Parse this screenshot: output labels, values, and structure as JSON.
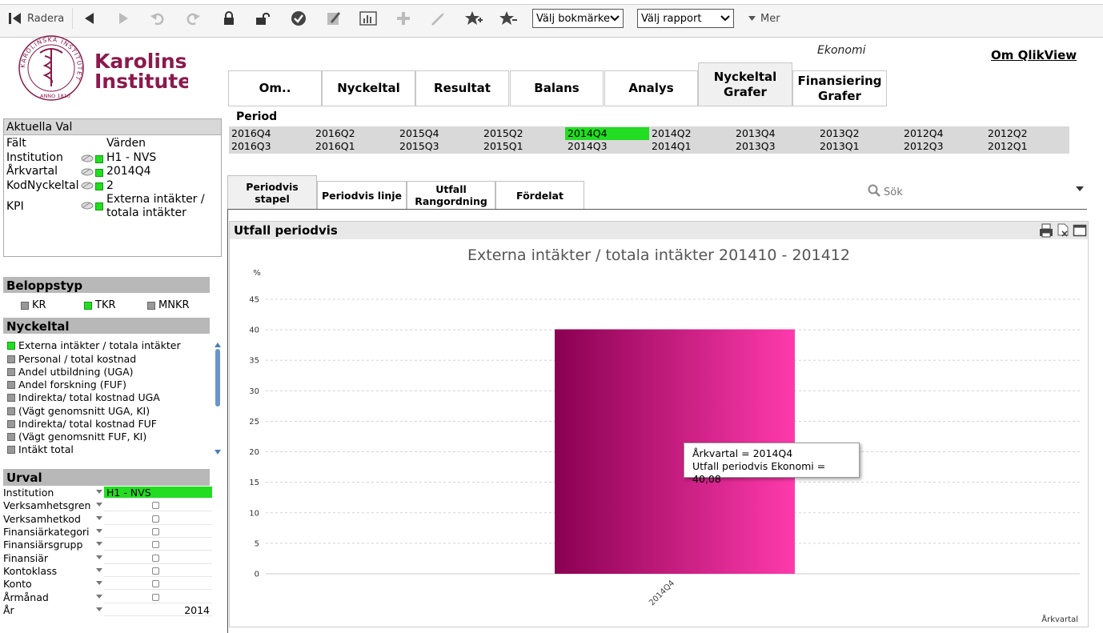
{
  "toolbar": {
    "clear_label": "Radera",
    "bookmark_select": "Välj bokmärke",
    "report_select": "Välj rapport",
    "more_label": "Mer"
  },
  "header": {
    "logo_line1": "Karolinska",
    "logo_line2": "Institutet",
    "seal_text": "KAROLINSKA INSTITUTET · ANNO 1810",
    "section_label": "Ekonomi",
    "about_link": "Om QlikView"
  },
  "main_tabs": [
    {
      "label": "Om..",
      "active": false
    },
    {
      "label": "Nyckeltal",
      "active": false
    },
    {
      "label": "Resultat",
      "active": false
    },
    {
      "label": "Balans",
      "active": false
    },
    {
      "label": "Analys",
      "active": false
    },
    {
      "label": "Nyckeltal Grafer",
      "active": true
    },
    {
      "label": "Finansiering Grafer",
      "active": false
    }
  ],
  "current_selections": {
    "title": "Aktuella Val",
    "col_field": "Fält",
    "col_values": "Värden",
    "rows": [
      {
        "field": "Institution",
        "value": "H1 - NVS"
      },
      {
        "field": "Årkvartal",
        "value": "2014Q4"
      },
      {
        "field": "KodNyckeltal",
        "value": "2"
      },
      {
        "field": "KPI",
        "value": "Externa intäkter / totala intäkter"
      }
    ]
  },
  "beloppstyp": {
    "title": "Beloppstyp",
    "options": [
      {
        "label": "KR",
        "selected": false
      },
      {
        "label": "TKR",
        "selected": true
      },
      {
        "label": "MNKR",
        "selected": false
      }
    ]
  },
  "nyckeltal": {
    "title": "Nyckeltal",
    "items": [
      {
        "label": "Externa intäkter / totala intäkter",
        "selected": true
      },
      {
        "label": "Personal / total kostnad",
        "selected": false
      },
      {
        "label": "Andel utbildning (UGA)",
        "selected": false
      },
      {
        "label": "Andel forskning (FUF)",
        "selected": false
      },
      {
        "label": "Indirekta/ total kostnad UGA",
        "selected": false
      },
      {
        "label": "(Vägt genomsnitt UGA, KI)",
        "selected": false
      },
      {
        "label": "Indirekta/ total kostnad FUF",
        "selected": false
      },
      {
        "label": "(Vägt genomsnitt FUF, KI)",
        "selected": false
      },
      {
        "label": "Intäkt total",
        "selected": false
      }
    ]
  },
  "urval": {
    "title": "Urval",
    "rows": [
      {
        "label": "Institution",
        "value": "H1 - NVS",
        "selected": true
      },
      {
        "label": "Verksamhetsgren",
        "value": "",
        "selected": false
      },
      {
        "label": "Verksamhetkod",
        "value": "",
        "selected": false
      },
      {
        "label": "Finansiärkategori",
        "value": "",
        "selected": false
      },
      {
        "label": "Finansiärsgrupp",
        "value": "",
        "selected": false
      },
      {
        "label": "Finansiär",
        "value": "",
        "selected": false
      },
      {
        "label": "Kontoklass",
        "value": "",
        "selected": false
      },
      {
        "label": "Konto",
        "value": "",
        "selected": false
      },
      {
        "label": "Årmånad",
        "value": "",
        "selected": false
      },
      {
        "label": "År",
        "value": "2014",
        "selected": false
      }
    ]
  },
  "period": {
    "label": "Period",
    "cells": [
      [
        "2016Q4",
        "2016Q3"
      ],
      [
        "2016Q2",
        "2016Q1"
      ],
      [
        "2015Q4",
        "2015Q3"
      ],
      [
        "2015Q2",
        "2015Q1"
      ],
      [
        "2014Q4",
        "2014Q3"
      ],
      [
        "2014Q2",
        "2014Q1"
      ],
      [
        "2013Q4",
        "2013Q3"
      ],
      [
        "2013Q2",
        "2013Q1"
      ],
      [
        "2012Q4",
        "2012Q3"
      ],
      [
        "2012Q2",
        "2012Q1"
      ]
    ],
    "selected": "2014Q4"
  },
  "sub_tabs": [
    {
      "label": "Periodvis stapel",
      "active": true
    },
    {
      "label": "Periodvis linje",
      "active": false
    },
    {
      "label": "Utfall Rangordning",
      "active": false
    },
    {
      "label": "Fördelat",
      "active": false
    }
  ],
  "search": {
    "placeholder": "Sök"
  },
  "chart_object": {
    "caption": "Utfall periodvis"
  },
  "chart_data": {
    "type": "bar",
    "title": "Externa intäkter / totala intäkter 201410 - 201412",
    "ylabel": "%",
    "xlabel": "Årkvartal",
    "categories": [
      "2014Q4"
    ],
    "values": [
      40.08
    ],
    "ylim": [
      0,
      45
    ],
    "yticks": [
      0,
      5,
      10,
      15,
      20,
      25,
      30,
      35,
      40,
      45
    ],
    "grid": true,
    "bar_gradient": [
      "#8a0052",
      "#ff3aac"
    ]
  },
  "tooltip": {
    "line1": "Årkvartal = 2014Q4",
    "line2": "Utfall periodvis  Ekonomi = 40,08"
  }
}
